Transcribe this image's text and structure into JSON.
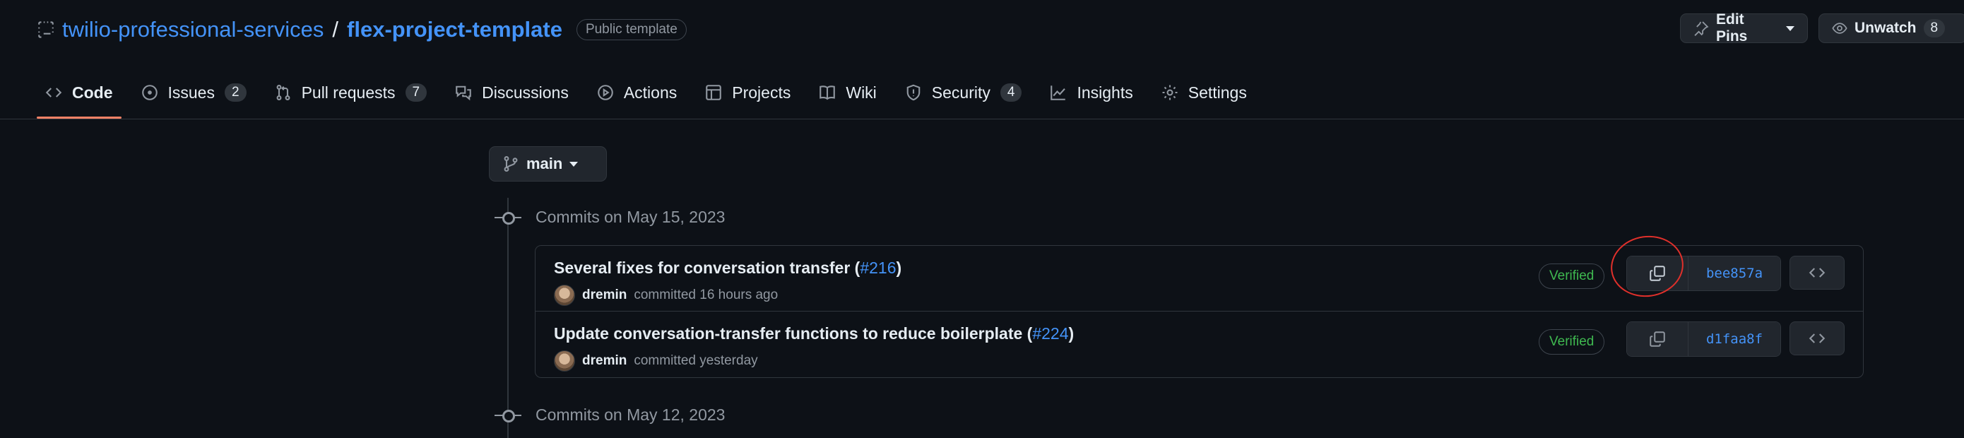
{
  "repo": {
    "owner": "twilio-professional-services",
    "separator": "/",
    "name": "flex-project-template",
    "visibility_badge": "Public template"
  },
  "header_actions": {
    "edit_pins_label": "Edit Pins",
    "unwatch_label": "Unwatch",
    "watch_count": "8"
  },
  "tabs": [
    {
      "label": "Code",
      "icon": "code-icon",
      "active": true
    },
    {
      "label": "Issues",
      "icon": "issue-opened-icon",
      "count": "2"
    },
    {
      "label": "Pull requests",
      "icon": "git-pull-request-icon",
      "count": "7"
    },
    {
      "label": "Discussions",
      "icon": "comment-discussion-icon"
    },
    {
      "label": "Actions",
      "icon": "play-icon"
    },
    {
      "label": "Projects",
      "icon": "table-icon"
    },
    {
      "label": "Wiki",
      "icon": "book-icon"
    },
    {
      "label": "Security",
      "icon": "shield-icon",
      "count": "4"
    },
    {
      "label": "Insights",
      "icon": "graph-icon"
    },
    {
      "label": "Settings",
      "icon": "gear-icon"
    }
  ],
  "branch": {
    "name": "main"
  },
  "commit_groups": [
    {
      "heading": "Commits on May 15, 2023",
      "commits": [
        {
          "title": "Several fixes for conversation transfer (",
          "pr": "#216",
          "title_end": ")",
          "author": "dremin",
          "meta": "committed 16 hours ago",
          "verified": "Verified",
          "sha": "bee857a"
        },
        {
          "title": "Update conversation-transfer functions to reduce boilerplate (",
          "pr": "#224",
          "title_end": ")",
          "author": "dremin",
          "meta": "committed yesterday",
          "verified": "Verified",
          "sha": "d1faa8f"
        }
      ]
    },
    {
      "heading": "Commits on May 12, 2023"
    }
  ],
  "colors": {
    "accent_link": "#4493f8",
    "verified": "#3fb950",
    "active_tab_underline": "#f78166",
    "annotation": "#e0302b",
    "background": "#0d1117"
  }
}
